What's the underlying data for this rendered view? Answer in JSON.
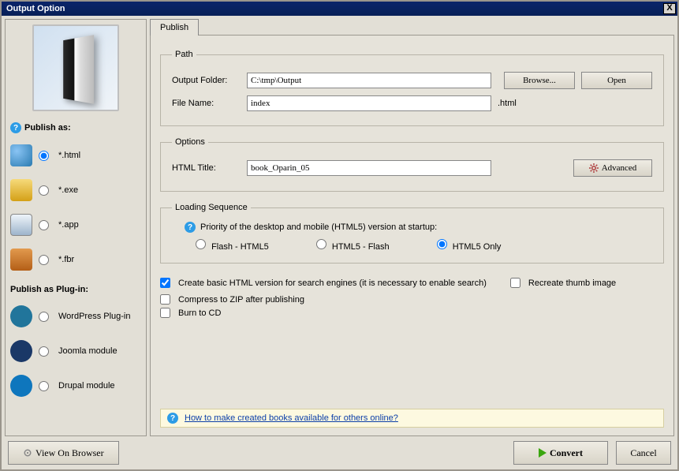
{
  "window": {
    "title": "Output Option",
    "close": "X"
  },
  "left": {
    "publish_as_label": "Publish as:",
    "formats": [
      {
        "label": "*.html",
        "checked": true,
        "icon": "fmt-html",
        "name": "publish-as-html"
      },
      {
        "label": "*.exe",
        "checked": false,
        "icon": "fmt-exe",
        "name": "publish-as-exe"
      },
      {
        "label": "*.app",
        "checked": false,
        "icon": "fmt-app",
        "name": "publish-as-app"
      },
      {
        "label": "*.fbr",
        "checked": false,
        "icon": "fmt-fbr",
        "name": "publish-as-fbr"
      }
    ],
    "plugin_label": "Publish as Plug-in:",
    "plugins": [
      {
        "label": "WordPress Plug-in",
        "icon": "fmt-wp",
        "name": "publish-as-wordpress"
      },
      {
        "label": "Joomla module",
        "icon": "fmt-joomla",
        "name": "publish-as-joomla"
      },
      {
        "label": "Drupal module",
        "icon": "fmt-drupal",
        "name": "publish-as-drupal"
      }
    ]
  },
  "tabs": {
    "publish": "Publish"
  },
  "path": {
    "legend": "Path",
    "output_folder_label": "Output Folder:",
    "output_folder_value": "C:\\tmp\\Output",
    "file_name_label": "File Name:",
    "file_name_value": "index",
    "file_ext": ".html",
    "browse_btn": "Browse...",
    "open_btn": "Open"
  },
  "options": {
    "legend": "Options",
    "html_title_label": "HTML Title:",
    "html_title_value": "book_Oparin_05",
    "advanced_btn": "Advanced"
  },
  "loading": {
    "legend": "Loading Sequence",
    "priority_text": "Priority of the desktop and mobile (HTML5) version at startup:",
    "opt1": "Flash - HTML5",
    "opt2": "HTML5 - Flash",
    "opt3": "HTML5 Only",
    "selected": "opt3"
  },
  "checks": {
    "create_basic": {
      "label": "Create basic HTML version for search engines (it is necessary to enable search)",
      "checked": true
    },
    "recreate_thumb": {
      "label": "Recreate thumb image",
      "checked": false
    },
    "compress_zip": {
      "label": "Compress to ZIP after publishing",
      "checked": false
    },
    "burn_cd": {
      "label": "Burn to CD",
      "checked": false
    }
  },
  "help_link_text": "How to make created books available for others online?",
  "footer": {
    "view_browser": "View On Browser",
    "convert": "Convert",
    "cancel": "Cancel"
  }
}
